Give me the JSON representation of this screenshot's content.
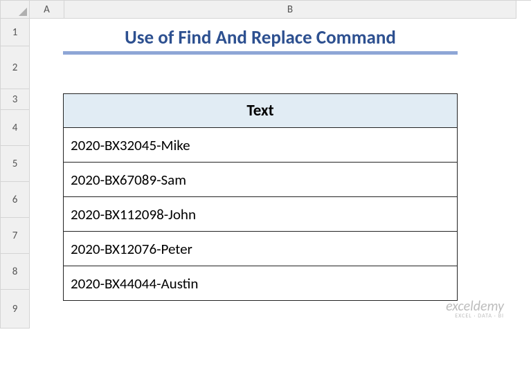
{
  "columns": [
    "",
    "A",
    "B"
  ],
  "rows": [
    "1",
    "2",
    "3",
    "4",
    "5",
    "6",
    "7",
    "8",
    "9"
  ],
  "title": "Use of Find And Replace Command",
  "table": {
    "header": "Text",
    "data": [
      "2020-BX32045-Mike",
      "2020-BX67089-Sam",
      "2020-BX112098-John",
      "2020-BX12076-Peter",
      "2020-BX44044-Austin"
    ]
  },
  "watermark": {
    "main": "exceldemy",
    "sub": "EXCEL · DATA · BI"
  }
}
